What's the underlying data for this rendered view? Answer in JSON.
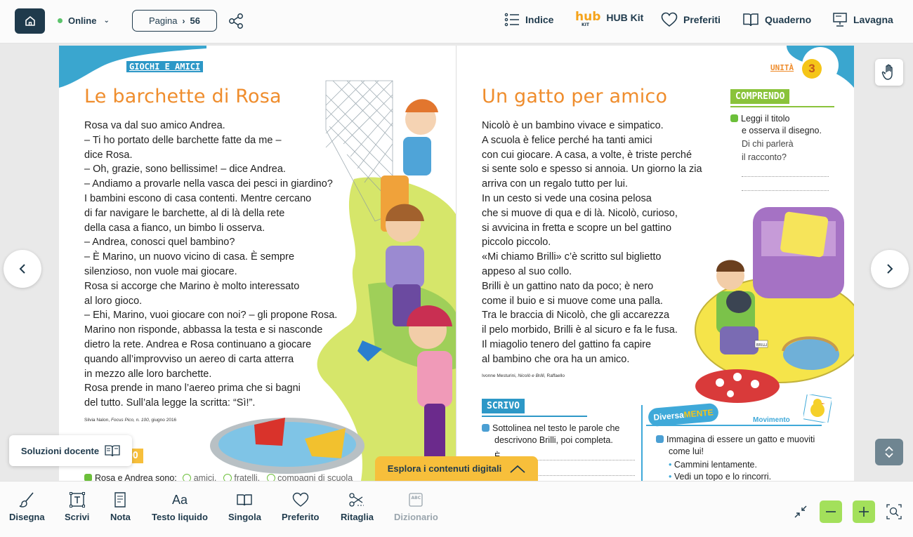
{
  "topbar": {
    "status": "Online",
    "page_label": "Pagina",
    "page_number": "56",
    "nav": {
      "indice": "Indice",
      "hub_logo": "hub",
      "hub_logo_sub": "KIT",
      "hub_kit": "HUB Kit",
      "preferiti": "Preferiti",
      "quaderno": "Quaderno",
      "lavagna": "Lavagna"
    }
  },
  "left_page": {
    "tag": "GIOCHI E AMICI",
    "title": "Le barchette di Rosa",
    "story": [
      "Rosa va dal suo amico Andrea.",
      "– Ti ho portato delle barchette fatte da me –",
      "dice Rosa.",
      "– Oh, grazie, sono bellissime! – dice Andrea.",
      "– Andiamo a provarle nella vasca dei pesci in giardino?",
      "I bambini escono di casa contenti. Mentre cercano",
      "di far navigare le barchette, al di là della rete",
      "della casa a fianco, un bimbo li osserva.",
      "– Andrea, conosci quel bambino?",
      "– È Marino, un nuovo vicino di casa. È sempre",
      "silenzioso, non vuole mai giocare.",
      "Rosa si accorge che Marino è molto interessato",
      "al loro gioco.",
      "– Ehi, Marino, vuoi giocare con noi? – gli propone Rosa.",
      "Marino non risponde, abbassa la testa e si nasconde",
      "dietro la rete. Andrea e Rosa continuano a giocare",
      "quando all’improvviso un aereo di carta atterra",
      "in mezzo alle loro barchette.",
      "Rosa prende in mano l’aereo prima che si bagni",
      "del tutto. Sull’ala legge la scritta: “Sì!”."
    ],
    "credit_author": "Silvia Nalon, ",
    "credit_source": "Focus Pico, n. 100,",
    "credit_date": " giugno 2016",
    "section_partial": "DO",
    "question": "Rosa e Andrea sono:",
    "options": [
      "amici.",
      "fratelli.",
      "compagni di scuola"
    ]
  },
  "right_page": {
    "unit_label": "UNITÀ",
    "unit_number": "3",
    "title": "Un gatto per amico",
    "story": [
      "Nicolò è un bambino vivace e simpatico.",
      "A scuola è felice perché ha tanti amici",
      "con cui giocare. A casa, a volte, è triste perché",
      "si sente solo e spesso si annoia. Un giorno la zia",
      "arriva con un regalo tutto per lui.",
      "In un cesto si vede una cosina pelosa",
      "che si muove di qua e di là. Nicolò, curioso,",
      "si avvicina in fretta e scopre un bel gattino",
      "piccolo piccolo.",
      "«Mi chiamo Brilli» c’è scritto sul biglietto",
      "appeso al suo collo.",
      "Brilli è un gattino nato da poco; è nero",
      "come il buio e si muove come una palla.",
      "Tra le braccia di Nicolò, che gli accarezza",
      "il pelo morbido, Brilli è al sicuro e fa le fusa.",
      "Il miagolio tenero del gattino fa capire",
      "al bambino che ora ha un amico."
    ],
    "credit_author": "Ivonne Mesturini, ",
    "credit_source": "Nicolò e Brilli,",
    "credit_publisher": " Raffaello",
    "comprendo": {
      "label": "COMPRENDO",
      "line1": "Leggi il titolo",
      "line2": "e osserva il disegno.",
      "line3": "Di chi parlerà",
      "line4": "il racconto?"
    },
    "scrivo": {
      "label": "SCRIVO",
      "line1": "Sottolinea nel testo le parole che",
      "line2": "descrivono Brilli, poi completa.",
      "line3": "È"
    },
    "diversamente": {
      "label_a": "Diversa",
      "label_b": "MENTE",
      "movimento": "Movimento",
      "line1": "Immagina di essere un gatto e muoviti",
      "line2": "come lui!",
      "item1": "Cammini lentamente.",
      "item2": "Vedi un topo e lo rincorri."
    },
    "basket_label": "BRILLI"
  },
  "floating": {
    "soluzioni": "Soluzioni docente",
    "esplora": "Esplora i contenuti digitali"
  },
  "toolbar": {
    "disegna": "Disegna",
    "scrivi": "Scrivi",
    "nota": "Nota",
    "testo_liquido": "Testo liquido",
    "testo_liquido_icon": "Aa",
    "singola": "Singola",
    "preferito": "Preferito",
    "ritaglia": "Ritaglia",
    "dizionario": "Dizionario"
  },
  "colors": {
    "navy": "#1f3a4c",
    "orange_title": "#ef8d2d",
    "zoom_green": "#a3e05b",
    "esplora_yellow": "#f7bf3b"
  }
}
